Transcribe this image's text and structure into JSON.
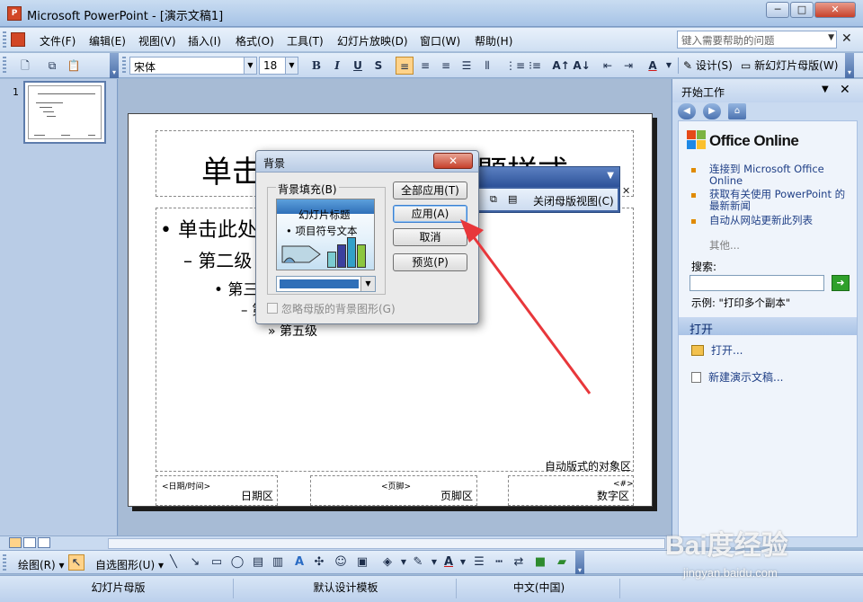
{
  "window": {
    "title": "Microsoft PowerPoint - [演示文稿1]",
    "buttons": [
      "─",
      "□",
      "✕"
    ]
  },
  "menu": {
    "items": [
      "文件(F)",
      "编辑(E)",
      "视图(V)",
      "插入(I)",
      "格式(O)",
      "工具(T)",
      "幻灯片放映(D)",
      "窗口(W)",
      "帮助(H)"
    ],
    "help_placeholder": "键入需要帮助的问题"
  },
  "toolbar": {
    "font": "宋体",
    "size": "18",
    "bold": "B",
    "italic": "I",
    "underline": "U",
    "shadow": "S",
    "design_label": "设计(S)",
    "new_master_label": "新幻灯片母版(W)"
  },
  "thumbnail": {
    "number": "1"
  },
  "slide": {
    "title_text": "单击此处编辑母版标题样式",
    "level1": "• 单击此处编辑母版文本样式",
    "level2": "– 第二级",
    "level3": "• 第三级",
    "level4": "– 第四级",
    "level5": "» 第五级",
    "object_area_label": "自动版式的对象区",
    "date_small": "<日期/时间>",
    "date_label": "日期区",
    "footer_small": "<页脚>",
    "footer_label": "页脚区",
    "number_small": "<#>",
    "number_label": "数字区"
  },
  "master_toolbar": {
    "close_view_label": "关闭母版视图(C)"
  },
  "dialog": {
    "title": "背景",
    "fill_label": "背景填充(B)",
    "preview_title": "幻灯片标题",
    "preview_bullet": "• 项目符号文本",
    "apply_all": "全部应用(T)",
    "apply": "应用(A)",
    "cancel": "取消",
    "preview": "预览(P)",
    "omit_master_graphics": "忽略母版的背景图形(G)",
    "fill_color": "#2f6fb8"
  },
  "taskpane": {
    "title": "开始工作",
    "office_online": "Office Online",
    "links": [
      "连接到 Microsoft Office Online",
      "获取有关使用 PowerPoint 的最新新闻",
      "自动从网站更新此列表"
    ],
    "more": "其他...",
    "search_label": "搜索:",
    "example": "示例: \"打印多个副本\"",
    "open_section": "打开",
    "open_action": "打开...",
    "new_action": "新建演示文稿..."
  },
  "drawing": {
    "draw_label": "绘图(R)",
    "autoshapes_label": "自选图形(U)"
  },
  "statusbar": {
    "cells": [
      "幻灯片母版",
      "默认设计模板",
      "中文(中国)"
    ]
  },
  "watermark": {
    "main": "Bai度经验",
    "sub": "jingyan.baidu.com"
  },
  "colors": {
    "accent": "#3f63a3",
    "arrow": "#e8373b"
  }
}
